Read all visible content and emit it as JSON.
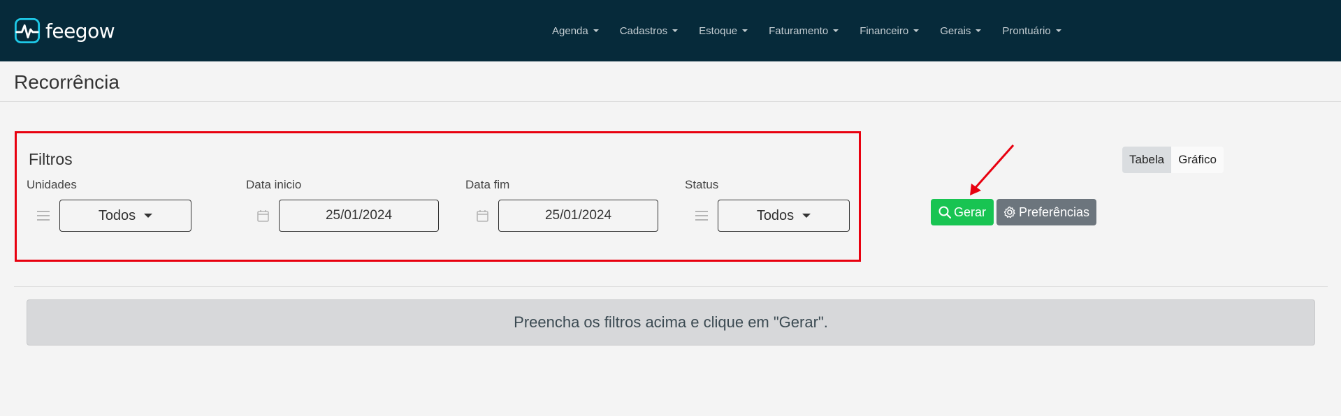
{
  "app": {
    "name": "feegow"
  },
  "nav": {
    "items": [
      {
        "label": "Agenda"
      },
      {
        "label": "Cadastros"
      },
      {
        "label": "Estoque"
      },
      {
        "label": "Faturamento"
      },
      {
        "label": "Financeiro"
      },
      {
        "label": "Gerais"
      },
      {
        "label": "Prontuário"
      }
    ]
  },
  "page": {
    "title": "Recorrência"
  },
  "filters": {
    "title": "Filtros",
    "unidades": {
      "label": "Unidades",
      "value": "Todos",
      "icon": "list-icon"
    },
    "data_inicio": {
      "label": "Data inicio",
      "value": "25/01/2024",
      "icon": "calendar-icon"
    },
    "data_fim": {
      "label": "Data fim",
      "value": "25/01/2024",
      "icon": "calendar-icon"
    },
    "status": {
      "label": "Status",
      "value": "Todos",
      "icon": "list-icon"
    }
  },
  "actions": {
    "gerar_label": "Gerar",
    "preferencias_label": "Preferências"
  },
  "view_toggle": {
    "tabela_label": "Tabela",
    "grafico_label": "Gráfico",
    "active": "Tabela"
  },
  "alert": {
    "message": "Preencha os filtros acima e clique em \"Gerar\"."
  },
  "colors": {
    "navbar": "#062a3a",
    "primary_green": "#18c452",
    "secondary_gray": "#6c757d",
    "highlight_red": "#e8000f",
    "logo_cyan": "#1ec8e6"
  }
}
